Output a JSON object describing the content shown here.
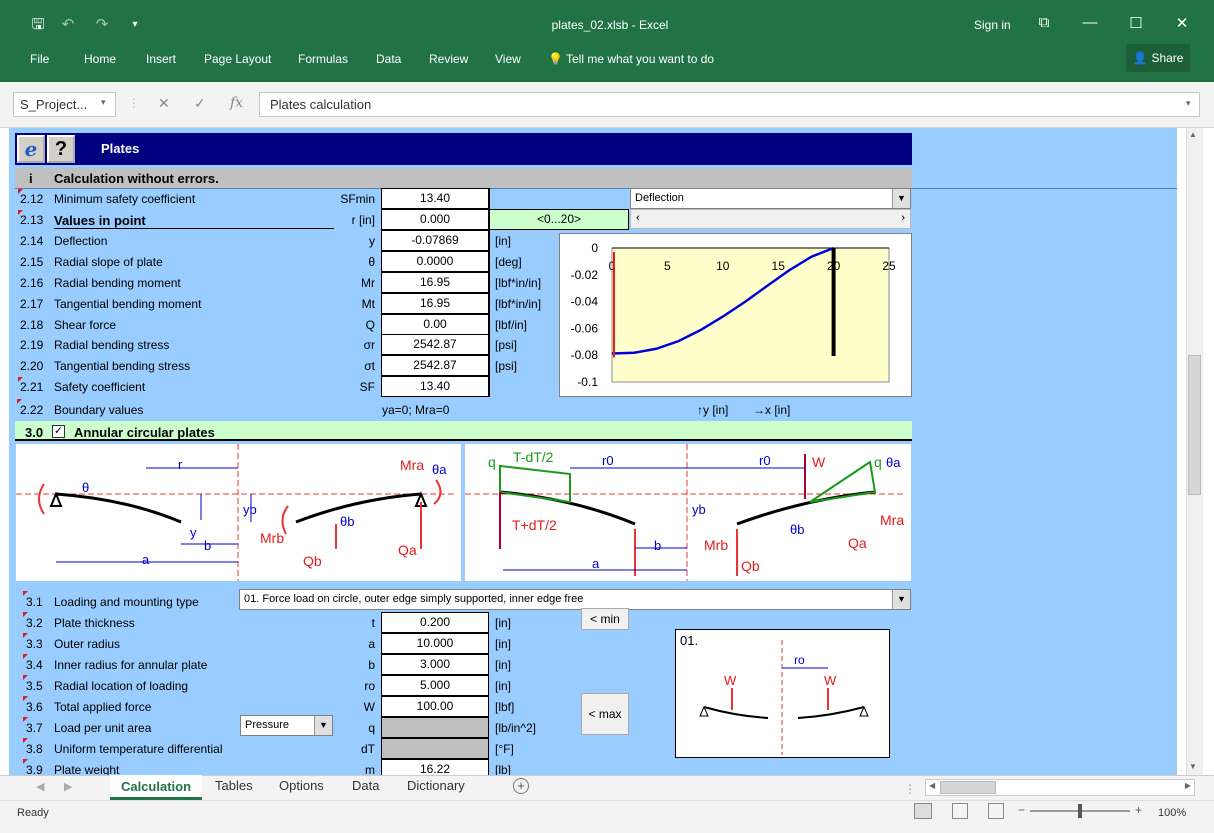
{
  "window": {
    "title": "plates_02.xlsb - Excel",
    "sign_in": "Sign in",
    "share": "Share"
  },
  "ribbon": {
    "tabs": [
      "File",
      "Home",
      "Insert",
      "Page Layout",
      "Formulas",
      "Data",
      "Review",
      "View"
    ],
    "tell_me": "Tell me what you want to do"
  },
  "formula_bar": {
    "name_box": "S_Project...",
    "formula": "Plates calculation"
  },
  "sheet": {
    "header_title": "Plates",
    "info_i": "i",
    "status_msg": "Calculation without errors.",
    "rows_top": [
      {
        "num": "2.12",
        "label": "Minimum safety coefficient",
        "sym": "SFmin",
        "value": "13.40",
        "unit": ""
      },
      {
        "num": "2.13",
        "label": "Values in point",
        "sym": "r [in]",
        "value": "0.000",
        "unit": "<0...20>"
      },
      {
        "num": "2.14",
        "label": "Deflection",
        "sym": "y",
        "value": "-0.07869",
        "unit": "[in]"
      },
      {
        "num": "2.15",
        "label": "Radial slope of plate",
        "sym": "θ",
        "value": "0.0000",
        "unit": "[deg]"
      },
      {
        "num": "2.16",
        "label": "Radial bending moment",
        "sym": "Mr",
        "value": "16.95",
        "unit": "[lbf*in/in]"
      },
      {
        "num": "2.17",
        "label": "Tangential bending moment",
        "sym": "Mt",
        "value": "16.95",
        "unit": "[lbf*in/in]"
      },
      {
        "num": "2.18",
        "label": "Shear force",
        "sym": "Q",
        "value": "0.00",
        "unit": "[lbf/in]"
      },
      {
        "num": "2.19",
        "label": "Radial bending stress",
        "sym": "σr",
        "value": "2542.87",
        "unit": "[psi]"
      },
      {
        "num": "2.20",
        "label": "Tangential bending stress",
        "sym": "σt",
        "value": "2542.87",
        "unit": "[psi]"
      },
      {
        "num": "2.21",
        "label": "Safety coefficient",
        "sym": "SF",
        "value": "13.40",
        "unit": ""
      }
    ],
    "row_2_22": {
      "num": "2.22",
      "label": "Boundary values",
      "value": "ya=0; Mra=0",
      "axis_y": "↑y [in]",
      "axis_x": "→x [in]"
    },
    "chart_select": "Deflection",
    "section3": {
      "num": "3.0",
      "title": "Annular circular plates"
    },
    "rows_bottom": [
      {
        "num": "3.2",
        "label": "Plate thickness",
        "sym": "t",
        "value": "0.200",
        "unit": "[in]"
      },
      {
        "num": "3.3",
        "label": "Outer radius",
        "sym": "a",
        "value": "10.000",
        "unit": "[in]"
      },
      {
        "num": "3.4",
        "label": "Inner radius for annular plate",
        "sym": "b",
        "value": "3.000",
        "unit": "[in]"
      },
      {
        "num": "3.5",
        "label": "Radial location of loading",
        "sym": "ro",
        "value": "5.000",
        "unit": "[in]"
      },
      {
        "num": "3.6",
        "label": "Total applied force",
        "sym": "W",
        "value": "100.00",
        "unit": "[lbf]"
      },
      {
        "num": "3.7",
        "label": "Load per unit area",
        "sym": "q",
        "value": "",
        "unit": "[lb/in^2]"
      },
      {
        "num": "3.8",
        "label": "Uniform temperature differential",
        "sym": "dT",
        "value": "",
        "unit": "[°F]"
      },
      {
        "num": "3.9",
        "label": "Plate weight",
        "sym": "m",
        "value": "16.22",
        "unit": "[lb]"
      }
    ],
    "row_3_1": {
      "num": "3.1",
      "label": "Loading and mounting type",
      "value": "01. Force load on circle, outer edge simply supported, inner edge free"
    },
    "pressure_select": "Pressure",
    "btn_min": "< min",
    "btn_max": "< max",
    "diagram_num": "01.",
    "diagram_labels": {
      "left": [
        "r",
        "θ",
        "y",
        "b",
        "a",
        "yb",
        "Mrb",
        "Qb",
        "θb",
        "Mra",
        "θa",
        "Qa"
      ],
      "right": [
        "q",
        "T-dT/2",
        "T+dT/2",
        "r0",
        "a",
        "b",
        "yb",
        "Mrb",
        "Qb",
        "θb",
        "W",
        "q",
        "θa",
        "Mra",
        "Qa"
      ],
      "small": [
        "W",
        "ro",
        "W"
      ]
    }
  },
  "chart_data": {
    "type": "line",
    "series": [
      {
        "x": [
          0,
          2,
          4,
          6,
          8,
          10,
          12,
          14,
          16,
          18,
          20
        ],
        "y": [
          -0.0787,
          -0.0782,
          -0.0752,
          -0.0695,
          -0.0612,
          -0.0512,
          -0.0402,
          -0.0283,
          -0.0166,
          -0.0065,
          0.0
        ]
      }
    ],
    "xlim": [
      0,
      25
    ],
    "ylim": [
      -0.1,
      0
    ],
    "xticks": [
      "0",
      "5",
      "10",
      "15",
      "20",
      "25"
    ],
    "yticks": [
      "0",
      "-0.02",
      "-0.04",
      "-0.06",
      "-0.08",
      "-0.1"
    ],
    "marker_line_x": 20,
    "grid": false,
    "line_color": "#0000dd",
    "bg_color": "#ffffcc"
  },
  "sheet_tabs": [
    "Calculation",
    "Tables",
    "Options",
    "Data",
    "Dictionary"
  ],
  "status": {
    "ready": "Ready",
    "zoom": "100%"
  }
}
